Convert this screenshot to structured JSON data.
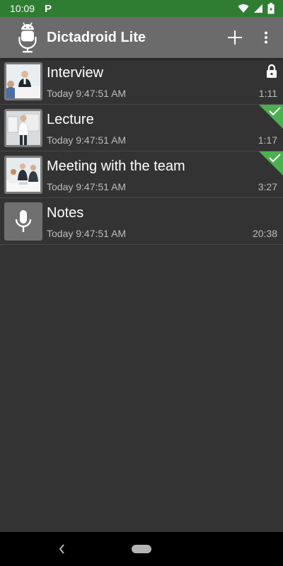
{
  "status_bar": {
    "time": "10:09",
    "notification": "P",
    "icons": [
      "wifi-icon",
      "cell-signal-icon",
      "battery-icon"
    ]
  },
  "app_bar": {
    "title": "Dictadroid Lite",
    "logo_icon": "android-mic-icon",
    "actions": [
      "add-icon",
      "more-vert-icon"
    ]
  },
  "recordings": [
    {
      "title": "Interview",
      "date": "Today 9:47:51 AM",
      "duration": "1:11",
      "thumbnail": "interview-photo",
      "badge": "lock-icon"
    },
    {
      "title": "Lecture",
      "date": "Today 9:47:51 AM",
      "duration": "1:17",
      "thumbnail": "lecture-photo",
      "badge": "check-corner-icon"
    },
    {
      "title": "Meeting with the team",
      "date": "Today 9:47:51 AM",
      "duration": "3:27",
      "thumbnail": "meeting-photo",
      "badge": "check-corner-icon"
    },
    {
      "title": "Notes",
      "date": "Today 9:47:51 AM",
      "duration": "20:38",
      "thumbnail": "mic-icon",
      "badge": ""
    }
  ],
  "colors": {
    "status_bar": "#2f7d32",
    "app_bar": "#6b6b6b",
    "background": "#333333",
    "check_badge": "#4caf50"
  },
  "nav_bar": {
    "icons": [
      "back-icon",
      "home-pill-icon"
    ]
  }
}
